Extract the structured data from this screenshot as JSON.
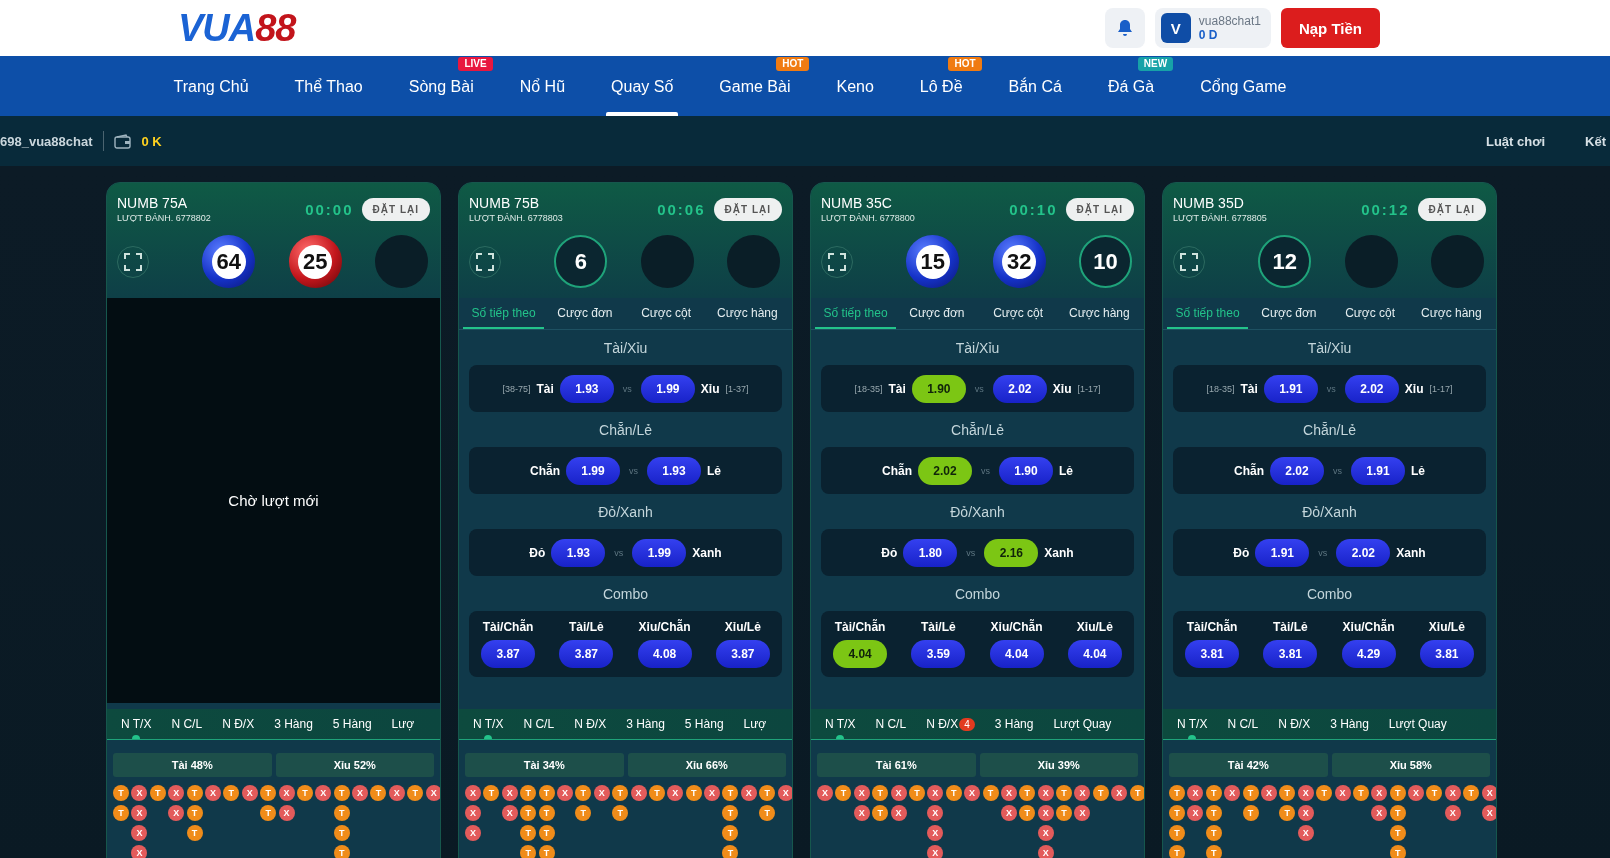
{
  "header": {
    "logo": {
      "letters": "VUA",
      "digits": "88"
    },
    "user": {
      "avatar": "V",
      "name": "vua88chat1",
      "balance": "0 D"
    },
    "deposit_button": "Nạp Tiền"
  },
  "nav": [
    {
      "label": "Trang Chủ",
      "selected": false
    },
    {
      "label": "Thể Thao",
      "selected": false
    },
    {
      "label": "Sòng Bài",
      "selected": false,
      "badge": "LIVE",
      "color": "#e8173f"
    },
    {
      "label": "Nổ Hũ",
      "selected": false
    },
    {
      "label": "Quay Số",
      "selected": true
    },
    {
      "label": "Game Bài",
      "selected": false,
      "badge": "HOT",
      "color": "#f07b12"
    },
    {
      "label": "Keno",
      "selected": false
    },
    {
      "label": "Lô Đề",
      "selected": false,
      "badge": "HOT",
      "color": "#f07b12"
    },
    {
      "label": "Bắn Cá",
      "selected": false
    },
    {
      "label": "Đá Gà",
      "selected": false,
      "badge": "NEW",
      "color": "#17a2a8"
    },
    {
      "label": "Cổng Game",
      "selected": false
    }
  ],
  "subbar": {
    "username": "698_vua88chat",
    "wallet": "0 K",
    "links": [
      "Luật chơi",
      "Kết"
    ]
  },
  "cards": [
    {
      "title": "NUMB 75A",
      "round": "LƯỢT ĐÁNH. 6778802",
      "timer": "00:00",
      "reset": "ĐẶT LẠI",
      "waiting": "Chờ lượt mới",
      "balls": [
        {
          "kind": "blue",
          "number": "64"
        },
        {
          "kind": "red",
          "number": "25"
        },
        {
          "kind": "empty"
        }
      ],
      "stat_tabs": [
        {
          "label": "N T/X",
          "selected": true
        },
        {
          "label": "N C/L",
          "selected": false
        },
        {
          "label": "N Đ/X",
          "selected": false
        },
        {
          "label": "3 Hàng",
          "selected": false
        },
        {
          "label": "5 Hàng",
          "selected": false
        },
        {
          "label": "Lượ",
          "selected": false
        }
      ],
      "stats": [
        "Tài 48%",
        "Xỉu 52%"
      ],
      "bead_rows": [
        [
          "T",
          "X",
          "T",
          "X",
          "T",
          "X",
          "T",
          "X",
          "T",
          "X",
          "T",
          "X",
          "T",
          "X",
          "T",
          "X",
          "T",
          "X"
        ],
        [
          "T",
          "X",
          null,
          "X",
          "T",
          null,
          null,
          null,
          "T",
          "X",
          null,
          null,
          "T",
          null,
          null,
          null,
          null,
          null
        ],
        [
          null,
          "X",
          null,
          null,
          "T",
          null,
          null,
          null,
          null,
          null,
          null,
          null,
          "T",
          null,
          null,
          null,
          null,
          null
        ],
        [
          null,
          "X",
          null,
          null,
          null,
          null,
          null,
          null,
          null,
          null,
          null,
          null,
          "T",
          null,
          null,
          null,
          null,
          null
        ]
      ]
    },
    {
      "title": "NUMB 75B",
      "round": "LƯỢT ĐÁNH. 6778803",
      "timer": "00:06",
      "reset": "ĐẶT LẠI",
      "balls": [
        {
          "kind": "ring",
          "number": "6"
        },
        {
          "kind": "empty"
        },
        {
          "kind": "empty"
        }
      ],
      "tabs": [
        {
          "label": "Số tiếp theo",
          "selected": true
        },
        {
          "label": "Cược đơn",
          "selected": false
        },
        {
          "label": "Cược cột",
          "selected": false
        },
        {
          "label": "Cược hàng",
          "selected": false
        }
      ],
      "markets": [
        {
          "title": "Tài/Xỉu",
          "left_range": "[38-75]",
          "left": "Tài",
          "left_odds": "1.93",
          "left_selected": false,
          "vs": "vs",
          "right_odds": "1.99",
          "right_selected": false,
          "right": "Xỉu",
          "right_range": "[1-37]"
        },
        {
          "title": "Chẵn/Lẻ",
          "left": "Chẵn",
          "left_odds": "1.99",
          "left_selected": false,
          "vs": "vs",
          "right_odds": "1.93",
          "right_selected": false,
          "right": "Lẻ"
        },
        {
          "title": "Đỏ/Xanh",
          "left": "Đỏ",
          "left_odds": "1.93",
          "left_selected": false,
          "vs": "vs",
          "right_odds": "1.99",
          "right_selected": false,
          "right": "Xanh"
        }
      ],
      "combo": {
        "title": "Combo",
        "items": [
          {
            "label": "Tài/Chẵn",
            "odds": "3.87",
            "selected": false
          },
          {
            "label": "Tài/Lẻ",
            "odds": "3.87",
            "selected": false
          },
          {
            "label": "Xỉu/Chẵn",
            "odds": "4.08",
            "selected": false
          },
          {
            "label": "Xỉu/Lẻ",
            "odds": "3.87",
            "selected": false
          }
        ]
      },
      "stat_tabs": [
        {
          "label": "N T/X",
          "selected": true
        },
        {
          "label": "N C/L",
          "selected": false
        },
        {
          "label": "N Đ/X",
          "selected": false
        },
        {
          "label": "3 Hàng",
          "selected": false
        },
        {
          "label": "5 Hàng",
          "selected": false
        },
        {
          "label": "Lượ",
          "selected": false
        }
      ],
      "stats": [
        "Tài 34%",
        "Xỉu 66%"
      ],
      "bead_rows": [
        [
          "X",
          "T",
          "X",
          "T",
          "T",
          "X",
          "T",
          "X",
          "T",
          "X",
          "T",
          "X",
          "T",
          "X",
          "T",
          "X",
          "T",
          "X"
        ],
        [
          "X",
          null,
          "X",
          "T",
          "T",
          null,
          "T",
          null,
          "T",
          null,
          null,
          null,
          null,
          null,
          "T",
          null,
          "T",
          null
        ],
        [
          "X",
          null,
          null,
          "T",
          "T",
          null,
          null,
          null,
          null,
          null,
          null,
          null,
          null,
          null,
          "T",
          null,
          null,
          null
        ],
        [
          null,
          null,
          null,
          "T",
          "T",
          null,
          null,
          null,
          null,
          null,
          null,
          null,
          null,
          null,
          "T",
          null,
          null,
          null
        ]
      ]
    },
    {
      "title": "NUMB 35C",
      "round": "LƯỢT ĐÁNH. 6778800",
      "timer": "00:10",
      "reset": "ĐẶT LẠI",
      "balls": [
        {
          "kind": "blue",
          "number": "15"
        },
        {
          "kind": "blue",
          "number": "32"
        },
        {
          "kind": "ring",
          "number": "10"
        }
      ],
      "tabs": [
        {
          "label": "Số tiếp theo",
          "selected": true
        },
        {
          "label": "Cược đơn",
          "selected": false
        },
        {
          "label": "Cược cột",
          "selected": false
        },
        {
          "label": "Cược hàng",
          "selected": false
        }
      ],
      "markets": [
        {
          "title": "Tài/Xỉu",
          "left_range": "[18-35]",
          "left": "Tài",
          "left_odds": "1.90",
          "left_selected": true,
          "vs": "vs",
          "right_odds": "2.02",
          "right_selected": false,
          "right": "Xỉu",
          "right_range": "[1-17]"
        },
        {
          "title": "Chẵn/Lẻ",
          "left": "Chẵn",
          "left_odds": "2.02",
          "left_selected": true,
          "vs": "vs",
          "right_odds": "1.90",
          "right_selected": false,
          "right": "Lẻ"
        },
        {
          "title": "Đỏ/Xanh",
          "left": "Đỏ",
          "left_odds": "1.80",
          "left_selected": false,
          "vs": "vs",
          "right_odds": "2.16",
          "right_selected": true,
          "right": "Xanh"
        }
      ],
      "combo": {
        "title": "Combo",
        "items": [
          {
            "label": "Tài/Chẵn",
            "odds": "4.04",
            "selected": true
          },
          {
            "label": "Tài/Lẻ",
            "odds": "3.59",
            "selected": false
          },
          {
            "label": "Xỉu/Chẵn",
            "odds": "4.04",
            "selected": false
          },
          {
            "label": "Xỉu/Lẻ",
            "odds": "4.04",
            "selected": false
          }
        ]
      },
      "stat_tabs": [
        {
          "label": "N T/X",
          "selected": true
        },
        {
          "label": "N C/L",
          "selected": false
        },
        {
          "label": "N Đ/X",
          "selected": false,
          "badge": "4"
        },
        {
          "label": "3 Hàng",
          "selected": false
        },
        {
          "label": "Lượt Quay",
          "selected": false
        }
      ],
      "stats": [
        "Tài 61%",
        "Xỉu 39%"
      ],
      "bead_rows": [
        [
          "X",
          "T",
          "X",
          "T",
          "X",
          "T",
          "X",
          "T",
          "X",
          "T",
          "X",
          "T",
          "X",
          "T",
          "X",
          "T",
          "X",
          "T"
        ],
        [
          null,
          null,
          "X",
          "T",
          "X",
          null,
          "X",
          null,
          null,
          null,
          "X",
          "T",
          "X",
          "T",
          "X",
          null,
          null,
          null
        ],
        [
          null,
          null,
          null,
          null,
          null,
          null,
          "X",
          null,
          null,
          null,
          null,
          null,
          "X",
          null,
          null,
          null,
          null,
          null
        ],
        [
          null,
          null,
          null,
          null,
          null,
          null,
          "X",
          null,
          null,
          null,
          null,
          null,
          "X",
          null,
          null,
          null,
          null,
          null
        ]
      ]
    },
    {
      "title": "NUMB 35D",
      "round": "LƯỢT ĐÁNH. 6778805",
      "timer": "00:12",
      "reset": "ĐẶT LẠI",
      "balls": [
        {
          "kind": "ring",
          "number": "12"
        },
        {
          "kind": "empty"
        },
        {
          "kind": "empty"
        }
      ],
      "tabs": [
        {
          "label": "Số tiếp theo",
          "selected": true
        },
        {
          "label": "Cược đơn",
          "selected": false
        },
        {
          "label": "Cược cột",
          "selected": false
        },
        {
          "label": "Cược hàng",
          "selected": false
        }
      ],
      "markets": [
        {
          "title": "Tài/Xỉu",
          "left_range": "[18-35]",
          "left": "Tài",
          "left_odds": "1.91",
          "left_selected": false,
          "vs": "vs",
          "right_odds": "2.02",
          "right_selected": false,
          "right": "Xỉu",
          "right_range": "[1-17]"
        },
        {
          "title": "Chẵn/Lẻ",
          "left": "Chẵn",
          "left_odds": "2.02",
          "left_selected": false,
          "vs": "vs",
          "right_odds": "1.91",
          "right_selected": false,
          "right": "Lẻ"
        },
        {
          "title": "Đỏ/Xanh",
          "left": "Đỏ",
          "left_odds": "1.91",
          "left_selected": false,
          "vs": "vs",
          "right_odds": "2.02",
          "right_selected": false,
          "right": "Xanh"
        }
      ],
      "combo": {
        "title": "Combo",
        "items": [
          {
            "label": "Tài/Chẵn",
            "odds": "3.81",
            "selected": false
          },
          {
            "label": "Tài/Lẻ",
            "odds": "3.81",
            "selected": false
          },
          {
            "label": "Xỉu/Chẵn",
            "odds": "4.29",
            "selected": false
          },
          {
            "label": "Xỉu/Lẻ",
            "odds": "3.81",
            "selected": false
          }
        ]
      },
      "stat_tabs": [
        {
          "label": "N T/X",
          "selected": true
        },
        {
          "label": "N C/L",
          "selected": false
        },
        {
          "label": "N Đ/X",
          "selected": false
        },
        {
          "label": "3 Hàng",
          "selected": false
        },
        {
          "label": "Lượt Quay",
          "selected": false
        }
      ],
      "stats": [
        "Tài 42%",
        "Xỉu 58%"
      ],
      "bead_rows": [
        [
          "T",
          "X",
          "T",
          "X",
          "T",
          "X",
          "T",
          "X",
          "T",
          "X",
          "T",
          "X",
          "T",
          "X",
          "T",
          "X",
          "T",
          "X"
        ],
        [
          "T",
          "X",
          "T",
          null,
          "T",
          null,
          "T",
          "X",
          null,
          null,
          null,
          "X",
          "T",
          null,
          null,
          "X",
          null,
          "X"
        ],
        [
          "T",
          null,
          "T",
          null,
          null,
          null,
          null,
          "X",
          null,
          null,
          null,
          null,
          "T",
          null,
          null,
          null,
          null,
          null
        ],
        [
          "T",
          null,
          "T",
          null,
          null,
          null,
          null,
          null,
          null,
          null,
          null,
          null,
          "T",
          null,
          null,
          null,
          null,
          null
        ]
      ]
    }
  ]
}
